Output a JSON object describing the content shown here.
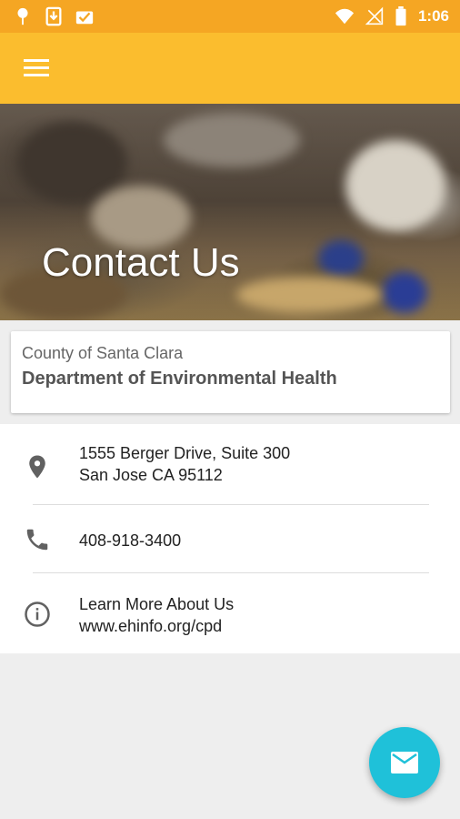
{
  "status_bar": {
    "time": "1:06",
    "left_icons": [
      "notification-pin-icon",
      "download-icon",
      "mail-check-icon"
    ],
    "right_icons": [
      "wifi-icon",
      "no-signal-icon",
      "battery-icon"
    ]
  },
  "toolbar": {
    "menu_icon": "hamburger-menu-icon"
  },
  "hero": {
    "title": "Contact Us"
  },
  "organization": {
    "county": "County of Santa Clara",
    "department": "Department of Environmental Health"
  },
  "contacts": {
    "address": {
      "icon": "location-pin-icon",
      "line1": "1555 Berger Drive, Suite 300",
      "line2": "San Jose CA 95112"
    },
    "phone": {
      "icon": "phone-icon",
      "number": "408-918-3400"
    },
    "info": {
      "icon": "info-icon",
      "line1": "Learn More About Us",
      "line2": "www.ehinfo.org/cpd"
    }
  },
  "fab": {
    "icon": "email-icon"
  },
  "colors": {
    "status_bar": "#f5a623",
    "toolbar": "#fbbd2e",
    "fab": "#1fc1d9",
    "icon_gray": "#616161"
  }
}
